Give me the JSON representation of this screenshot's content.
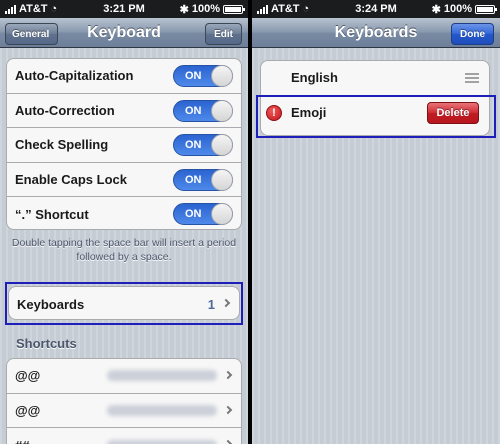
{
  "left": {
    "status": {
      "carrier": "AT&T",
      "time": "3:21 PM",
      "battery": "100%"
    },
    "nav": {
      "back": "General",
      "title": "Keyboard",
      "action": "Edit"
    },
    "settings": [
      {
        "label": "Auto-Capitalization",
        "toggle": "ON"
      },
      {
        "label": "Auto-Correction",
        "toggle": "ON"
      },
      {
        "label": "Check Spelling",
        "toggle": "ON"
      },
      {
        "label": "Enable Caps Lock",
        "toggle": "ON"
      },
      {
        "label": "“.” Shortcut",
        "toggle": "ON"
      }
    ],
    "footnote": "Double tapping the space bar will insert a period followed by a space.",
    "keyboards_row": {
      "label": "Keyboards",
      "count": "1"
    },
    "shortcuts_header": "Shortcuts",
    "shortcuts": [
      {
        "phrase": "@@"
      },
      {
        "phrase": "@@"
      },
      {
        "phrase": "##"
      }
    ]
  },
  "right": {
    "status": {
      "carrier": "AT&T",
      "time": "3:24 PM",
      "battery": "100%"
    },
    "nav": {
      "title": "Keyboards",
      "action": "Done"
    },
    "keyboards": [
      {
        "label": "English"
      },
      {
        "label": "Emoji",
        "delete": "Delete"
      }
    ]
  },
  "colors": {
    "highlight": "#1e1eb8",
    "toggle_on": "#2b64d0",
    "delete": "#c01c24"
  }
}
